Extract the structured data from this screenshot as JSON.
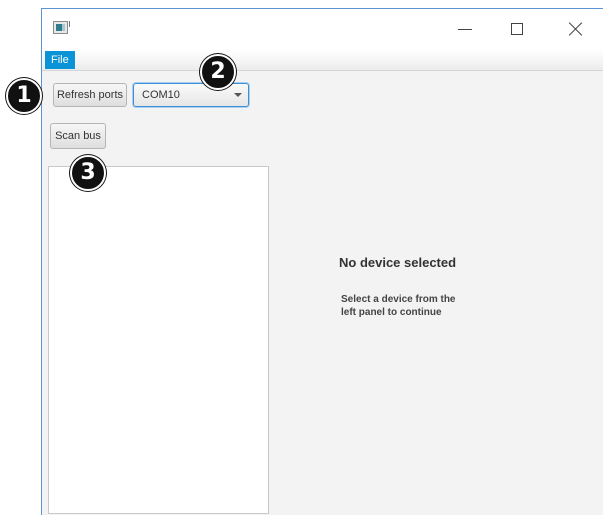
{
  "window": {
    "close_glyph": "✕"
  },
  "menubar": {
    "file_label": "File"
  },
  "toolbar": {
    "refresh_label": "Refresh ports",
    "port_value": "COM10",
    "scan_label": "Scan bus"
  },
  "details": {
    "empty_title": "No device selected",
    "empty_line1": "Select a device from the",
    "empty_line2": "left panel to continue"
  },
  "markers": [
    "1",
    "2",
    "3"
  ],
  "colors": {
    "accent": "#0a93d6",
    "focus_border": "#3c8fd6",
    "marker_bg": "#111111"
  },
  "icons": {
    "app": "app-icon",
    "minimize": "minimize-icon",
    "maximize": "maximize-icon",
    "close": "close-icon",
    "dropdown": "chevron-down-icon"
  }
}
